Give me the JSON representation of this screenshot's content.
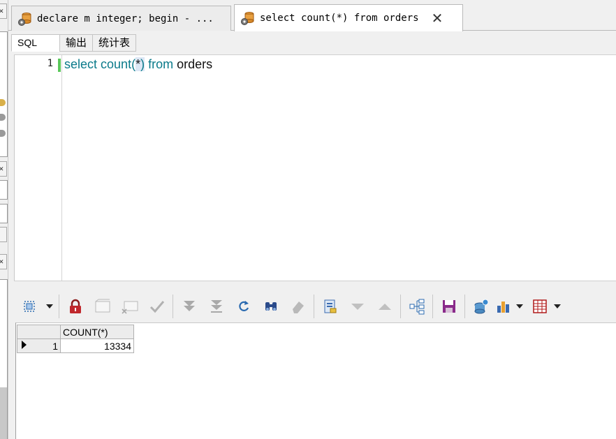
{
  "tabs": [
    {
      "label": "declare m integer; begin - ...",
      "active": false
    },
    {
      "label": "select count(*) from orders",
      "active": true
    }
  ],
  "subtabs": [
    {
      "label": "SQL",
      "active": true
    },
    {
      "label": "输出",
      "active": false
    },
    {
      "label": "统计表",
      "active": false
    }
  ],
  "editor": {
    "line_number": "1",
    "code": {
      "kw1": "select",
      "fn": " count(",
      "star": "*",
      "close": ")",
      "kw2": " from",
      "table": " orders"
    }
  },
  "toolbar": {
    "icons": [
      "select-mode-icon",
      "lock-icon",
      "insert-record-icon",
      "delete-record-icon",
      "post-changes-icon",
      "last-page-icon",
      "fetch-all-icon",
      "refresh-icon",
      "find-icon",
      "clear-icon",
      "query-by-example-icon",
      "next-icon",
      "previous-icon",
      "tree-view-icon",
      "save-icon",
      "export-icon",
      "chart-icon",
      "grid-options-icon"
    ]
  },
  "grid": {
    "columns": [
      "COUNT(*)"
    ],
    "rows": [
      {
        "num": "1",
        "values": [
          "13334"
        ]
      }
    ]
  },
  "colors": {
    "keyword": "#0a7a8a",
    "change_marker": "#5ac85a",
    "lock_red": "#c0282d",
    "save_purple": "#8a2a8a"
  }
}
